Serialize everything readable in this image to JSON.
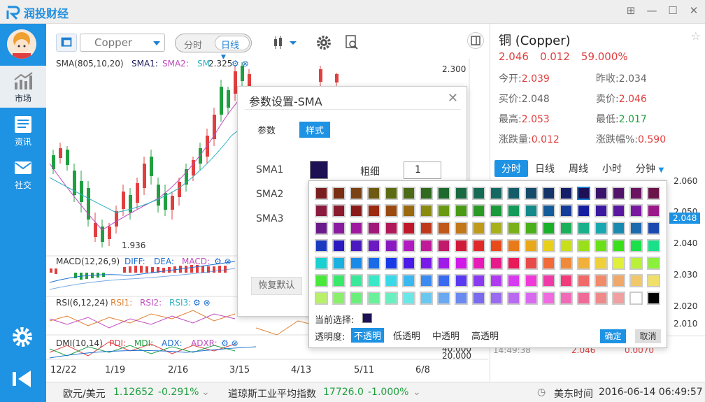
{
  "app": {
    "logo_text_1": "润投",
    "logo_text_2": "财经"
  },
  "sidebar": {
    "items": [
      {
        "label": "市场",
        "icon": "chart-icon"
      },
      {
        "label": "资讯",
        "icon": "news-icon"
      },
      {
        "label": "社交",
        "icon": "mail-icon"
      }
    ]
  },
  "toolbar": {
    "symbol": "Copper",
    "period_intraday": "分时",
    "period_daily": "日线"
  },
  "chart": {
    "sma_label": "SMA(805,10,20)",
    "sma1": "SMA1:",
    "sma2": "SMA2:",
    "sma3_partial": "SM",
    "sma_value": "2.325",
    "price_high_label": "2.300",
    "price_low_label": "1.936",
    "macd_label": "MACD(12,26,9)",
    "diff": "DIFF:",
    "dea": "DEA:",
    "macd": "MACD:",
    "rsi_label": "RSI(6,12,24)",
    "rsi1": "RSI1:",
    "rsi2": "RSI2:",
    "rsi3": "RSI3:",
    "dmi_label": "DMI(10,14)",
    "pdi": "PDI:",
    "mdi": "MDI:",
    "adx": "ADX:",
    "adxr": "ADXR:",
    "dmi_val1": "40.000",
    "dmi_val2": "20.000",
    "x_ticks": [
      "12/22",
      "1/19",
      "2/16",
      "3/15",
      "4/13",
      "5/11",
      "6/8"
    ]
  },
  "chart_data": {
    "type": "candlestick",
    "x_ticks": [
      "12/22",
      "1/19",
      "2/16",
      "3/15",
      "4/13",
      "5/11",
      "6/8"
    ],
    "price_labels": [
      "2.300",
      "1.936"
    ]
  },
  "right_panel": {
    "title": "铜 (Copper)",
    "price": "2.046",
    "change": "0.012",
    "change_pct": "59.000%",
    "quotes": [
      {
        "l1": "今开:",
        "v1": "2.039",
        "l2": "昨收:",
        "v2": "2.034"
      },
      {
        "l1": "买价:",
        "v1": "2.048",
        "l2": "卖价:",
        "v2": "2.046"
      },
      {
        "l1": "最高:",
        "v1": "2.053",
        "l2": "最低:",
        "v2": "2.017"
      },
      {
        "l1": "涨跌量:",
        "v1": "0.012",
        "l2": "涨跌幅%:",
        "v2": "0.590"
      }
    ],
    "tabs": [
      "分时",
      "日线",
      "周线",
      "小时",
      "分钟"
    ],
    "axis": [
      "2.060",
      "2.050",
      "2.048",
      "2.040",
      "2.030",
      "2.020",
      "2.010"
    ],
    "current": "2.048",
    "tick_time": "14:49:38",
    "tick_price": "2.046",
    "tick_vol": "0.0070"
  },
  "dialog": {
    "title": "参数设置-SMA",
    "tab_params": "参数",
    "tab_style": "样式",
    "sma1": "SMA1",
    "sma2": "SMA2",
    "sma3": "SMA3",
    "thickness_label": "粗细",
    "thickness_value": "1",
    "reset": "恢复默认"
  },
  "palette": {
    "current_label": "当前选择:",
    "opacity_label": "透明度:",
    "opacity_options": [
      "不透明",
      "低透明",
      "中透明",
      "高透明"
    ],
    "ok": "确定",
    "cancel": "取消",
    "colors": [
      [
        "#7a1f1f",
        "#7a2f12",
        "#7a4212",
        "#6e5a12",
        "#5c6a14",
        "#4a6a16",
        "#2f6a1e",
        "#1e6a2c",
        "#186a40",
        "#146a52",
        "#146a62",
        "#145c6a",
        "#144a6a",
        "#14346a",
        "#141f6a",
        "#1d1055",
        "#3a146a",
        "#52146a",
        "#6a1462",
        "#6a144a"
      ],
      [
        "#8a1a3e",
        "#8a1a2c",
        "#8a1a1a",
        "#9a2a10",
        "#9a4a10",
        "#9a6a10",
        "#8a8a10",
        "#6a9a14",
        "#4a9a18",
        "#2a9a24",
        "#1a9a3a",
        "#149a5a",
        "#148a8a",
        "#145c9a",
        "#143c9a",
        "#141ea0",
        "#3a18a0",
        "#5a18a0",
        "#7a18a0",
        "#9a188a"
      ],
      [
        "#6a1a8a",
        "#8a1aa0",
        "#a018a0",
        "#a0187a",
        "#b0185a",
        "#c0182a",
        "#c0381a",
        "#c0581a",
        "#c0781a",
        "#c09a1a",
        "#a8b01a",
        "#7ab01a",
        "#4ab01a",
        "#1ab02a",
        "#1ab05a",
        "#1ab08a",
        "#1aa8b0",
        "#1a8ab0",
        "#1a6ab0",
        "#1a4ab0"
      ],
      [
        "#1a3ac0",
        "#2a1ac0",
        "#4a1ac0",
        "#6a1ac0",
        "#8a1ac0",
        "#b01ac0",
        "#c01a9a",
        "#c01a6a",
        "#d01a3a",
        "#e02a2a",
        "#e84a1a",
        "#e87a1a",
        "#e8a81a",
        "#e8d01a",
        "#c8e01a",
        "#9ae01a",
        "#6ae01a",
        "#3ae01a",
        "#1ae04a",
        "#1ae08a"
      ],
      [
        "#1ad0d0",
        "#1ab0e0",
        "#1a8ae8",
        "#1a6ae8",
        "#1a3ae8",
        "#4a1ae8",
        "#7a1ae8",
        "#a01ae8",
        "#d01ae8",
        "#e81ab8",
        "#e81a8a",
        "#e81a5a",
        "#e84a4a",
        "#f06a3a",
        "#f08a3a",
        "#f0b03a",
        "#f0d03a",
        "#e0f03a",
        "#b8f03a",
        "#8af03a"
      ],
      [
        "#4ae83a",
        "#3ae86a",
        "#3ae89a",
        "#3ae8c8",
        "#3ad8e8",
        "#3ab8f0",
        "#3a8af0",
        "#3a6af0",
        "#5a3af0",
        "#8a3af0",
        "#b03af0",
        "#d83af0",
        "#f03ad8",
        "#f03aa8",
        "#f03a7a",
        "#f06a6a",
        "#f08a6a",
        "#f0a86a",
        "#f0c86a",
        "#f0e06a"
      ],
      [
        "#b8f06a",
        "#8af06a",
        "#6af07a",
        "#6af09a",
        "#6af0c0",
        "#6ae8e8",
        "#6ac8f0",
        "#6aa8f0",
        "#6a8af0",
        "#7a6af0",
        "#9a6af0",
        "#b86af0",
        "#d86af0",
        "#f06ae0",
        "#f06ab8",
        "#f06a98",
        "#f08a8a",
        "#f0a0a0",
        "#ffffff",
        "#000000"
      ]
    ]
  },
  "status": {
    "item1_name": "欧元/美元",
    "item1_value": "1.12652",
    "item1_change": "-0.291%",
    "item2_name": "道琼斯工业平均指数",
    "item2_value": "17726.0",
    "item2_change": "-1.000%",
    "time_label": "美东时间",
    "time_value": "2016-06-14 06:49:57"
  }
}
